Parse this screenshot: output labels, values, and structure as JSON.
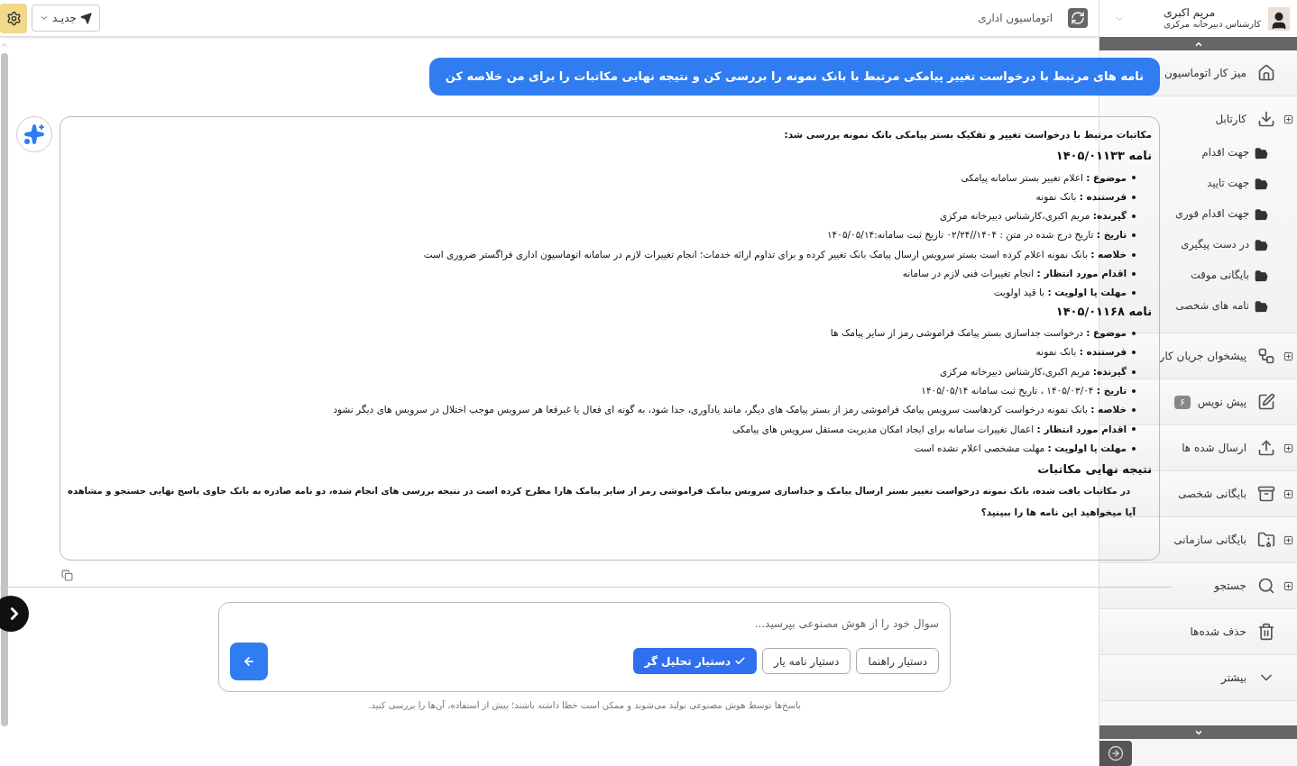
{
  "topbar": {
    "new_button": {
      "label": "جدیـد"
    },
    "title": "اتوماسیون اداری"
  },
  "user": {
    "name": "مریم اکبری",
    "role": "کارشناس دبیرخانه مرکزی"
  },
  "sidebar": {
    "items": [
      {
        "label": "میز کار اتوماسیون",
        "expandable": false
      },
      {
        "label": "کارتابل",
        "expandable": true,
        "children": [
          {
            "label": "جهت اقدام"
          },
          {
            "label": "جهت تایید"
          },
          {
            "label": "جهت اقدام فوری"
          },
          {
            "label": "در دست پیگیری"
          },
          {
            "label": "بایگانی موقت"
          },
          {
            "label": "نامه های شخصی"
          }
        ]
      },
      {
        "label": "پیشخوان جریان کار",
        "expandable": true
      },
      {
        "label": "پیش نویس",
        "expandable": false,
        "badge": "۶"
      },
      {
        "label": "ارسال شده ها",
        "expandable": true
      },
      {
        "label": "بایگانی شخصی",
        "expandable": true
      },
      {
        "label": "بایگانی سازمانی",
        "expandable": true
      },
      {
        "label": "جستجو",
        "expandable": true
      },
      {
        "label": "حذف شده‌ها",
        "expandable": false
      },
      {
        "label": "بیشتر",
        "expandable": false
      }
    ]
  },
  "chat": {
    "user_message": "نامه های مرتبط با درخواست تغییر پیامکی مرتبط با بانک نمونه را بررسی کن و نتیجه نهایی مکاتبات را برای من خلاصه کن",
    "answer": {
      "intro": "مکاتبات مرتبط با درخواست تغییر و تفکیک بستر پیامکی بانک نمونه بررسی شد:",
      "letters": [
        {
          "title": "نامه ۱۴۰۵/۰۱۱۳۳",
          "items": [
            "**موضوع :** اعلام تغییر بستر سامانه پیامکی",
            "**فرستنده :** بانک نمونه",
            "**گیرنده:** مریم اکبری،کارشناس دبیرخانه مرکزی",
            "**تاریخ :** تاریخ درج شده در متن : ۱۴۰۴//۰۲/۲۴ تاریخ ثبت سامانه:۱۴۰۵/۰۵/۱۴",
            "**خلاصه :** بانک نمونه اعلام کرده است بستر سرویس ارسال پیامک بانک تغییر کرده و برای تداوم ارائه خدمات؛ انجام تغییرات لازم در سامانه اتوماسیون اداری فراگستر ضروری است",
            "**اقدام مورد انتظار :** انجام تغییرات فنی لازم در سامانه",
            "**مهلت یا اولویت :** با قید اولویت"
          ]
        },
        {
          "title": "نامه ۱۴۰۵/۰۱۱۶۸",
          "items": [
            "**موضوع :** درخواست جداسازی بستر پیامک فراموشی رمز از سایر پیامک ها",
            "**فرستنده :** بانک نمونه",
            "**گیرنده:** مریم اکبری،کارشناس دبیرخانه مرکزی",
            "**تاریخ :** ۱۴۰۵/۰۳/۰۴ ، تاریخ ثبت سامانه ۱۴۰۵/۰۵/۱۴",
            "**خلاصه :** بانک نمونه درخواست کردهاست سرویس پیامک فراموشی رمز از بستر پیامک های دیگر، مانند یادآوری، جدا شود، به گونه ای فعال یا غیرفعا هر سرویس موجب اختلال در سرویس های دیگر نشود",
            "**اقدام مورد انتظار :** اعمال تغییرات سامانه برای ایجاد امکان مدیریت مستقل سرویس های پیامکی",
            "**مهلت یا اولویت :** مهلت مشخصی اعلام نشده است"
          ]
        }
      ],
      "result_title": "نتیجه نهایی مکاتبات",
      "result_text": "در مکاتبات یافت شده، بانک نمونه درخواست تغییر بستر ارسال پیامک و جداسازی سرویس پیامک فراموشی رمز از سایر پیامک هارا مطرح کرده است  در نتیجه بررسی های انجام شده، دو نامه صادره به بانک حاوی پاسخ نهایی جستجو و مشاهده",
      "question": "آیا میخواهید این نامه ها را ببینید؟"
    }
  },
  "composer": {
    "placeholder": "سوال خود را از هوش مصنوعی بپرسید...",
    "assistants": [
      {
        "label": "دستیار راهنما",
        "selected": false
      },
      {
        "label": "دستیار نامه یار",
        "selected": false
      },
      {
        "label": "دستیار تحلیل گر",
        "selected": true
      }
    ],
    "disclaimer": "پاسخ‌ها توسط هوش مصنوعی تولید می‌شوند و ممکن است خطا داشته باشند؛ پیش از استفاده، آن‌ها را بررسی کنید."
  }
}
